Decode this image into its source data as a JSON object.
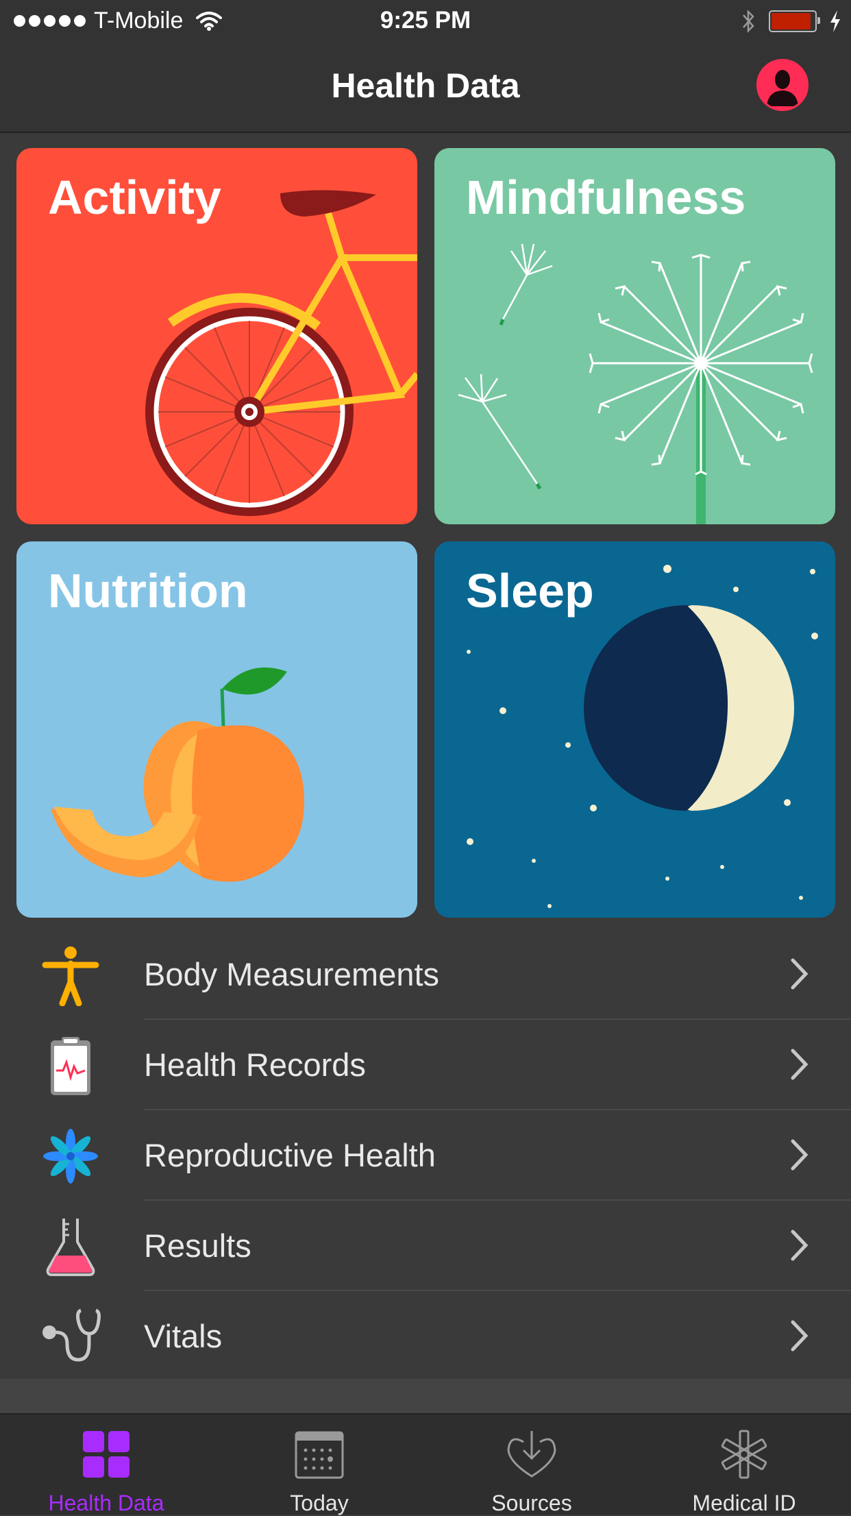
{
  "status_bar": {
    "carrier": "T-Mobile",
    "time": "9:25 PM",
    "battery_color": "#c01f00"
  },
  "nav": {
    "title": "Health Data",
    "profile_icon": "person-icon",
    "accent": "#ff2d55"
  },
  "tiles": [
    {
      "title": "Activity",
      "color": "#ff4f3a",
      "icon": "bicycle-icon"
    },
    {
      "title": "Mindfulness",
      "color": "#78c8a4",
      "icon": "dandelion-icon"
    },
    {
      "title": "Nutrition",
      "color": "#86c4e6",
      "icon": "peach-icon"
    },
    {
      "title": "Sleep",
      "color": "#0a6792",
      "icon": "moon-icon"
    }
  ],
  "categories": [
    {
      "label": "Body Measurements",
      "icon": "person-figure-icon"
    },
    {
      "label": "Health Records",
      "icon": "clipboard-icon"
    },
    {
      "label": "Reproductive Health",
      "icon": "flower-icon"
    },
    {
      "label": "Results",
      "icon": "flask-icon"
    },
    {
      "label": "Vitals",
      "icon": "stethoscope-icon"
    }
  ],
  "tabbar": {
    "active_color": "#a92cff",
    "tabs": [
      {
        "label": "Health Data",
        "icon": "grid-icon",
        "active": true
      },
      {
        "label": "Today",
        "icon": "calendar-icon",
        "active": false
      },
      {
        "label": "Sources",
        "icon": "download-heart-icon",
        "active": false
      },
      {
        "label": "Medical ID",
        "icon": "asterisk-icon",
        "active": false
      }
    ]
  }
}
